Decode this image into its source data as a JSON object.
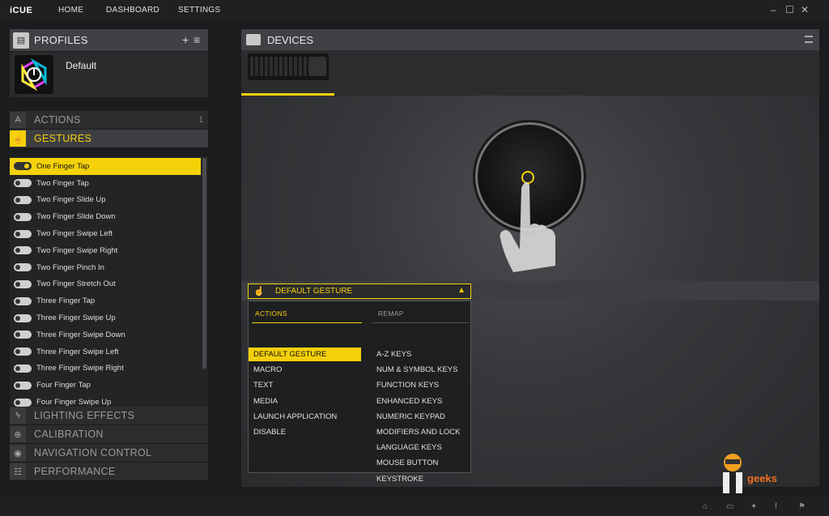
{
  "app": {
    "title": "iCUE"
  },
  "nav": {
    "home": "HOME",
    "dashboard": "DASHBOARD",
    "settings": "SETTINGS"
  },
  "window_controls": {
    "minimize": "–",
    "maximize": "☐",
    "close": "✕"
  },
  "profiles": {
    "header": "PROFILES",
    "add_icon": "+",
    "menu_icon": "≡",
    "current": "Default"
  },
  "sections": {
    "actions": {
      "label": "ACTIONS",
      "count": "1"
    },
    "gestures": {
      "label": "GESTURES"
    },
    "lighting": {
      "label": "LIGHTING EFFECTS"
    },
    "calibration": {
      "label": "CALIBRATION"
    },
    "navigation": {
      "label": "NAVIGATION CONTROL"
    },
    "performance": {
      "label": "PERFORMANCE"
    }
  },
  "gestures": [
    "One Finger Tap",
    "Two Finger Tap",
    "Two Finger Slide Up",
    "Two Finger Slide Down",
    "Two Finger Swipe Left",
    "Two Finger Swipe Right",
    "Two Finger Pinch In",
    "Two Finger Stretch Out",
    "Three Finger Tap",
    "Three Finger Swipe Up",
    "Three Finger Swipe Down",
    "Three Finger Swipe Left",
    "Three Finger Swipe Right",
    "Four Finger Tap",
    "Four Finger Swipe Up"
  ],
  "devices": {
    "header": "DEVICES"
  },
  "dropdown": {
    "selected": "DEFAULT GESTURE",
    "actions_header": "ACTIONS",
    "remap_header": "REMAP",
    "actions": [
      "DEFAULT GESTURE",
      "MACRO",
      "TEXT",
      "MEDIA",
      "LAUNCH APPLICATION",
      "DISABLE"
    ],
    "remap": [
      "A-Z KEYS",
      "NUM & SYMBOL KEYS",
      "FUNCTION KEYS",
      "ENHANCED KEYS",
      "NUMERIC KEYPAD",
      "MODIFIERS AND LOCK ...",
      "LANGUAGE KEYS",
      "MOUSE BUTTON",
      "KEYSTROKE"
    ]
  },
  "watermark": {
    "text": "geeks"
  },
  "colors": {
    "accent": "#f5d10a",
    "panel": "#2b2c2e",
    "header": "#404144"
  }
}
